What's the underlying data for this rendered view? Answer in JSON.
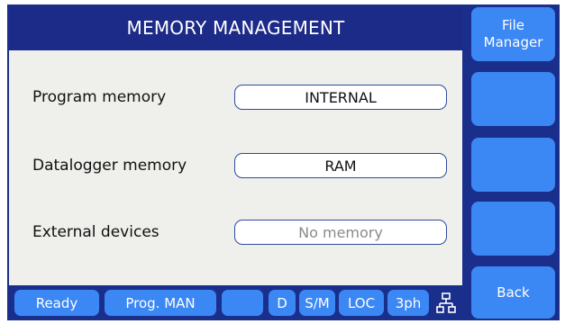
{
  "header": {
    "title": "MEMORY MANAGEMENT"
  },
  "rows": [
    {
      "label": "Program memory",
      "value": "INTERNAL",
      "enabled": true
    },
    {
      "label": "Datalogger memory",
      "value": "RAM",
      "enabled": true
    },
    {
      "label": "External devices",
      "value": "No memory",
      "enabled": false
    }
  ],
  "softkeys": [
    {
      "label": "File\nManager"
    },
    {
      "label": ""
    },
    {
      "label": ""
    },
    {
      "label": ""
    },
    {
      "label": "Back"
    }
  ],
  "status": {
    "state": "Ready",
    "program": "Prog. MAN",
    "blank": "",
    "d": "D",
    "sm": "S/M",
    "loc": "LOC",
    "phase": "3ph",
    "icon": "network-icon"
  },
  "colors": {
    "frame": "#1a2f8c",
    "button": "#3b87f4",
    "panel": "#efefec"
  }
}
